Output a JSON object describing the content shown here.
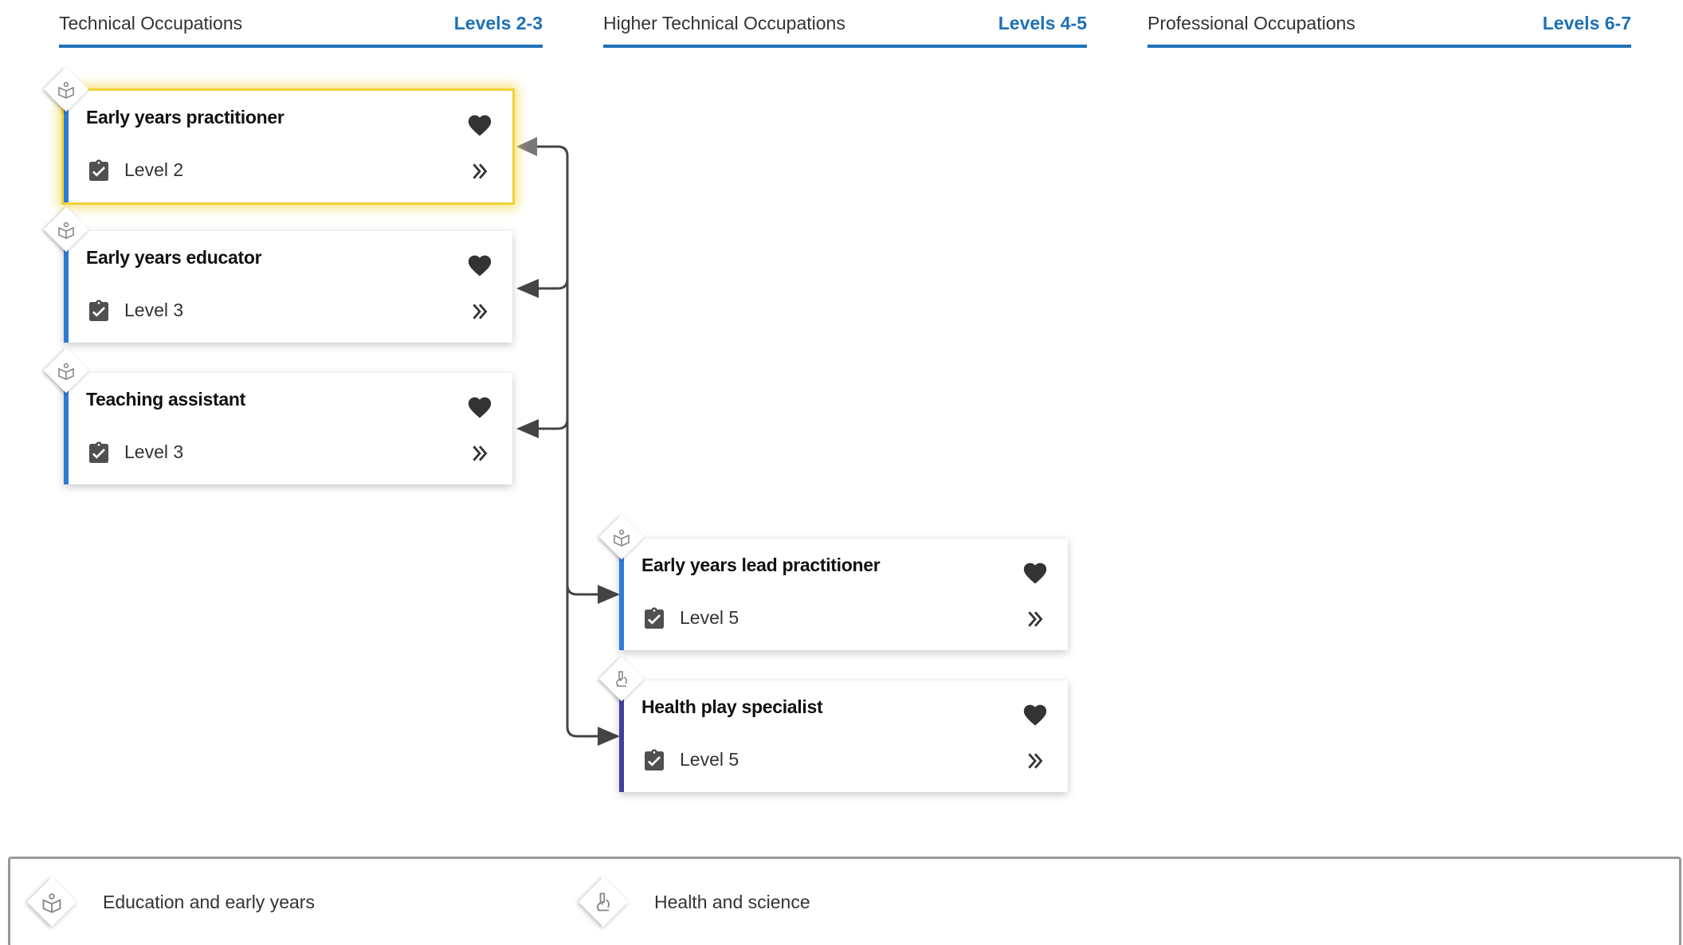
{
  "columns": [
    {
      "title": "Technical Occupations",
      "levels": "Levels 2-3"
    },
    {
      "title": "Higher Technical Occupations",
      "levels": "Levels 4-5"
    },
    {
      "title": "Professional Occupations",
      "levels": "Levels 6-7"
    }
  ],
  "cards": [
    {
      "title": "Early years practitioner",
      "level": "Level 2",
      "route": "book-icon",
      "selected": true
    },
    {
      "title": "Early years educator",
      "level": "Level 3",
      "route": "book-icon",
      "selected": false
    },
    {
      "title": "Teaching assistant",
      "level": "Level 3",
      "route": "book-icon",
      "selected": false
    },
    {
      "title": "Early years lead practitioner",
      "level": "Level 5",
      "route": "book-icon",
      "selected": false
    },
    {
      "title": "Health play specialist",
      "level": "Level 5",
      "route": "microscope-icon",
      "selected": false
    }
  ],
  "legend": [
    {
      "label": "Education and early years",
      "icon": "book-icon"
    },
    {
      "label": "Health and science",
      "icon": "microscope-icon"
    }
  ],
  "colors": {
    "accent": "#1d70b8",
    "education_route": "#2e7bd6",
    "health_route": "#3f3f9f",
    "selected_highlight": "#f1d33a",
    "connector": "#444444"
  }
}
